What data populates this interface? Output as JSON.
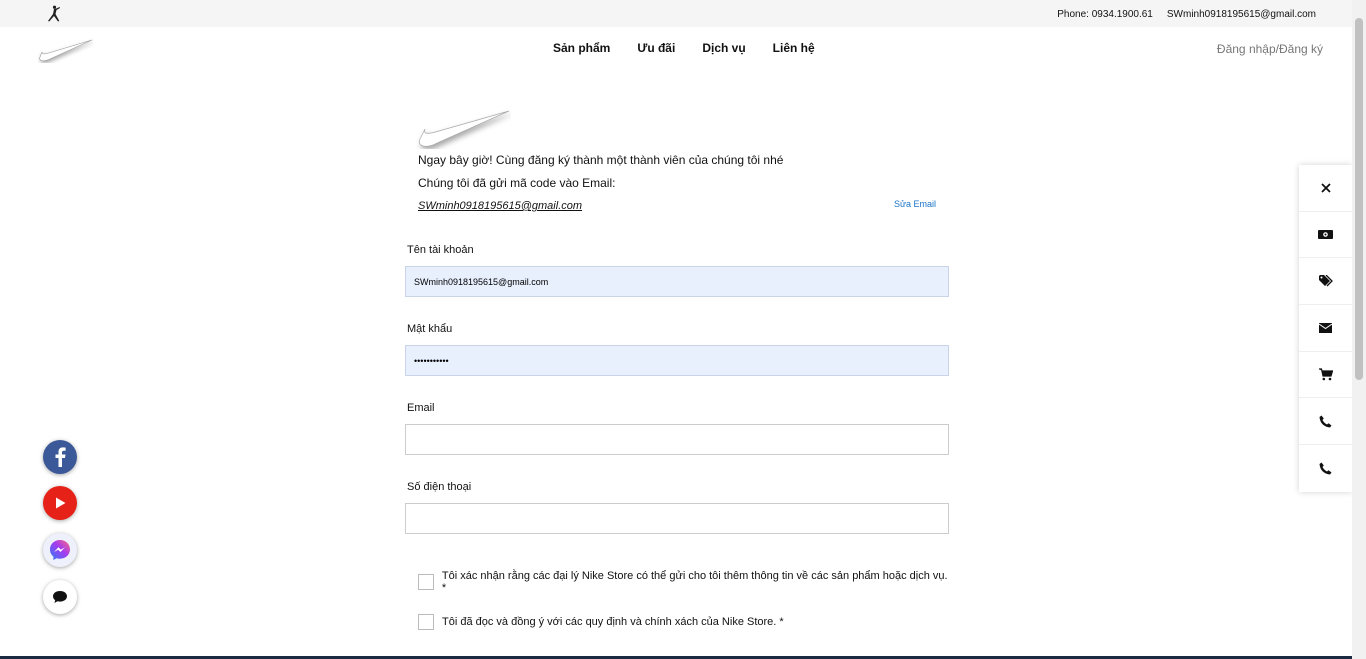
{
  "topbar": {
    "phone": "Phone: 0934.1900.61",
    "email": "SWminh0918195615@gmail.com"
  },
  "nav": {
    "items": [
      "Sản phẩm",
      "Ưu đãi",
      "Dịch vụ",
      "Liên hệ"
    ],
    "login": "Đăng nhập/Đăng ký"
  },
  "form": {
    "intro": "Ngay bây giờ! Cùng đăng ký thành một thành viên của chúng tôi nhé",
    "sent_text": "Chúng tôi đã gửi mã code vào Email:",
    "sent_email": "SWminh0918195615@gmail.com",
    "edit_email": "Sửa Email",
    "account_label": "Tên tài khoản",
    "account_value": "SWminh0918195615@gmail.com",
    "password_label": "Mật khẩu",
    "password_value": "•••••••••••",
    "email_label": "Email",
    "email_value": "",
    "phone_label": "Số điện thoại",
    "phone_value": "",
    "consent_1": "Tôi xác nhận rằng các đại lý Nike Store có thể gửi cho tôi thêm thông tin về các sản phẩm hoặc dịch vụ. *",
    "consent_2": "Tôi đã đọc và đồng ý với các quy định và chính xách của Nike Store. *"
  },
  "right_panel": [
    "close-icon",
    "money-icon",
    "tag-icon",
    "envelope-icon",
    "cart-icon",
    "phone-icon",
    "phone-icon"
  ],
  "social": [
    "facebook-icon",
    "youtube-icon",
    "messenger-icon",
    "chat-icon"
  ],
  "colors": {
    "input_fill": "#e8f0fe",
    "link": "#1a73c7",
    "facebook": "#3b5998",
    "youtube": "#e62117"
  }
}
